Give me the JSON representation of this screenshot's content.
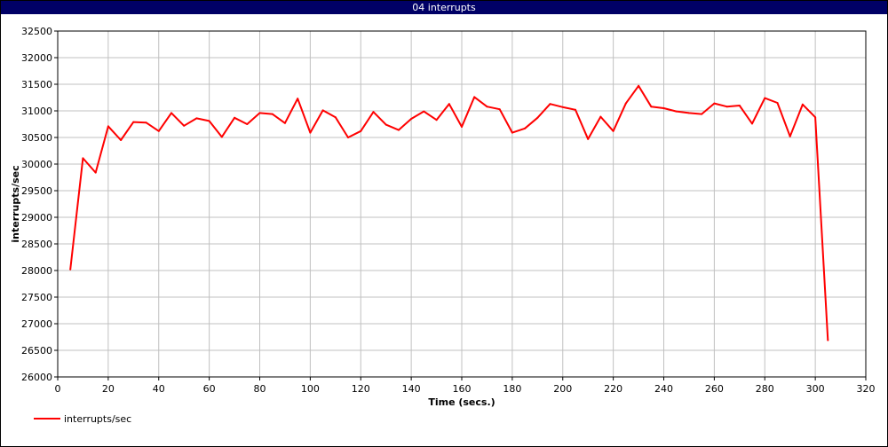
{
  "window": {
    "title": "04 interrupts"
  },
  "colors": {
    "titlebar": "#000066",
    "series": "#ff0000",
    "grid": "#c0c0c0"
  },
  "chart_data": {
    "type": "line",
    "title": "04 interrupts",
    "xlabel": "Time (secs.)",
    "ylabel": "interrupts/sec",
    "xlim": [
      0,
      320
    ],
    "ylim": [
      26000,
      32500
    ],
    "x_ticks": [
      0,
      20,
      40,
      60,
      80,
      100,
      120,
      140,
      160,
      180,
      200,
      220,
      240,
      260,
      280,
      300,
      320
    ],
    "y_ticks": [
      26000,
      26500,
      27000,
      27500,
      28000,
      28500,
      29000,
      29500,
      30000,
      30500,
      31000,
      31500,
      32000,
      32500
    ],
    "grid": true,
    "legend_position": "bottom-left",
    "series": [
      {
        "name": "interrupts/sec",
        "color": "#ff0000",
        "x": [
          5,
          10,
          15,
          20,
          25,
          30,
          35,
          40,
          45,
          50,
          55,
          60,
          65,
          70,
          75,
          80,
          85,
          90,
          95,
          100,
          105,
          110,
          115,
          120,
          125,
          130,
          135,
          140,
          145,
          150,
          155,
          160,
          165,
          170,
          175,
          180,
          185,
          190,
          195,
          200,
          205,
          210,
          215,
          220,
          225,
          230,
          235,
          240,
          245,
          250,
          255,
          260,
          265,
          270,
          275,
          280,
          285,
          290,
          295,
          300,
          305
        ],
        "y": [
          28020,
          30110,
          29840,
          30710,
          30450,
          30790,
          30780,
          30620,
          30960,
          30720,
          30860,
          30810,
          30510,
          30870,
          30750,
          30960,
          30940,
          30770,
          31230,
          30590,
          31010,
          30880,
          30500,
          30620,
          30980,
          30740,
          30640,
          30850,
          30990,
          30830,
          31130,
          30700,
          31260,
          31080,
          31030,
          30590,
          30670,
          30870,
          31130,
          31070,
          31020,
          30470,
          30890,
          30620,
          31140,
          31470,
          31080,
          31050,
          30990,
          30960,
          30940,
          31140,
          31080,
          31100,
          30760,
          31240,
          31150,
          30520,
          31120,
          30880,
          26690
        ]
      }
    ]
  }
}
